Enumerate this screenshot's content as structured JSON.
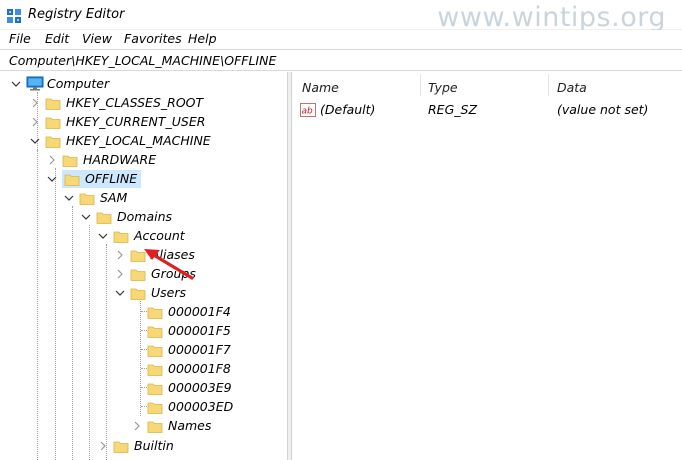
{
  "window": {
    "title": "Registry Editor",
    "watermark": "www.wintips.org"
  },
  "menu": {
    "items": [
      "File",
      "Edit",
      "View",
      "Favorites",
      "Help"
    ]
  },
  "address": {
    "path": "Computer\\HKEY_LOCAL_MACHINE\\OFFLINE"
  },
  "tree": {
    "root": "Computer",
    "nodes": [
      "HKEY_CLASSES_ROOT",
      "HKEY_CURRENT_USER",
      "HKEY_LOCAL_MACHINE",
      "HARDWARE",
      "OFFLINE",
      "SAM",
      "Domains",
      "Account",
      "Aliases",
      "Groups",
      "Users",
      "000001F4",
      "000001F5",
      "000001F7",
      "000001F8",
      "000003E9",
      "000003ED",
      "Names",
      "Builtin"
    ],
    "selected": "OFFLINE"
  },
  "values": {
    "columns": [
      "Name",
      "Type",
      "Data"
    ],
    "rows": [
      {
        "name": "(Default)",
        "type": "REG_SZ",
        "data": "(value not set)"
      }
    ]
  },
  "colors": {
    "selection": "#cce8ff",
    "folder": "#f8d775",
    "arrow": "#e02020"
  }
}
